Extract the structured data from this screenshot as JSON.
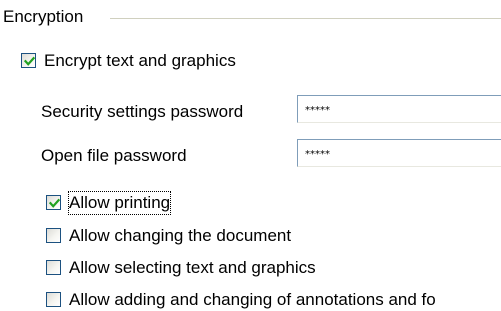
{
  "group": {
    "title": "Encryption"
  },
  "encrypt_checkbox": {
    "label": "Encrypt text and graphics",
    "checked": true
  },
  "security_password": {
    "label": "Security settings password",
    "value": "*****"
  },
  "open_password": {
    "label": "Open file password",
    "value": "*****"
  },
  "permissions": [
    {
      "label": "Allow printing",
      "checked": true
    },
    {
      "label": "Allow changing the document",
      "checked": false
    },
    {
      "label": "Allow selecting text and graphics",
      "checked": false
    },
    {
      "label": "Allow adding and changing of annotations and fo",
      "checked": false
    }
  ],
  "colors": {
    "checkmark": "#21a121",
    "checkbox_border": "#1c5180",
    "field_border": "#7f9db9"
  },
  "icons": {
    "checkmark": "checkmark-icon"
  }
}
